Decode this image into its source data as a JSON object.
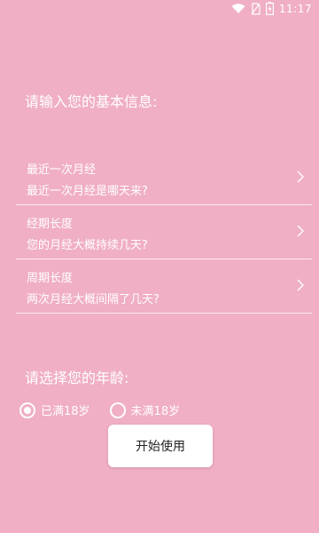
{
  "status_bar": {
    "time": "11:17",
    "icons": [
      "wifi-icon",
      "no-sim-icon",
      "battery-charging-icon"
    ]
  },
  "basic_info": {
    "title": "请输入您的基本信息:",
    "items": [
      {
        "title": "最近一次月经",
        "subtitle": "最近一次月经是哪天来?",
        "icon": "chevron-right-icon"
      },
      {
        "title": "经期长度",
        "subtitle": "您的月经大概持续几天?",
        "icon": "chevron-right-icon"
      },
      {
        "title": "周期长度",
        "subtitle": "两次月经大概间隔了几天?",
        "icon": "chevron-right-icon"
      }
    ]
  },
  "age": {
    "title": "请选择您的年龄:",
    "options": [
      {
        "label": "已满18岁",
        "selected": true
      },
      {
        "label": "未满18岁",
        "selected": false
      }
    ]
  },
  "start_button": {
    "label": "开始使用"
  },
  "colors": {
    "background": "#f0afc4",
    "text": "#ffffff",
    "button_bg": "#ffffff",
    "button_text": "#222222"
  }
}
